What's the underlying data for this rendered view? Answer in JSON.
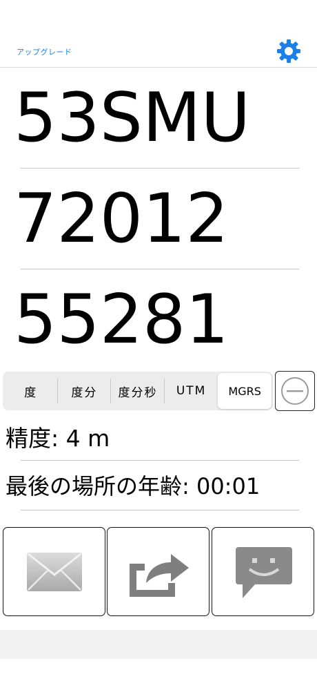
{
  "header": {
    "upgrade_label": "アップグレード",
    "settings_icon": "gear-icon",
    "accent_color": "#1a7fe6"
  },
  "coordinates": {
    "zone": "53SMU",
    "easting": "72012",
    "northing": "55281"
  },
  "format_selector": {
    "options": [
      "度",
      "度分",
      "度分秒",
      "UTM",
      "MGRS"
    ],
    "selected": "MGRS"
  },
  "minus_button_icon": "minus-circle-icon",
  "info": {
    "accuracy": "精度: 4 m",
    "location_age": "最後の場所の年齢: 00:01"
  },
  "actions": [
    {
      "name": "email",
      "icon": "envelope-icon"
    },
    {
      "name": "share",
      "icon": "share-arrow-icon"
    },
    {
      "name": "message",
      "icon": "chat-bubble-icon"
    }
  ]
}
